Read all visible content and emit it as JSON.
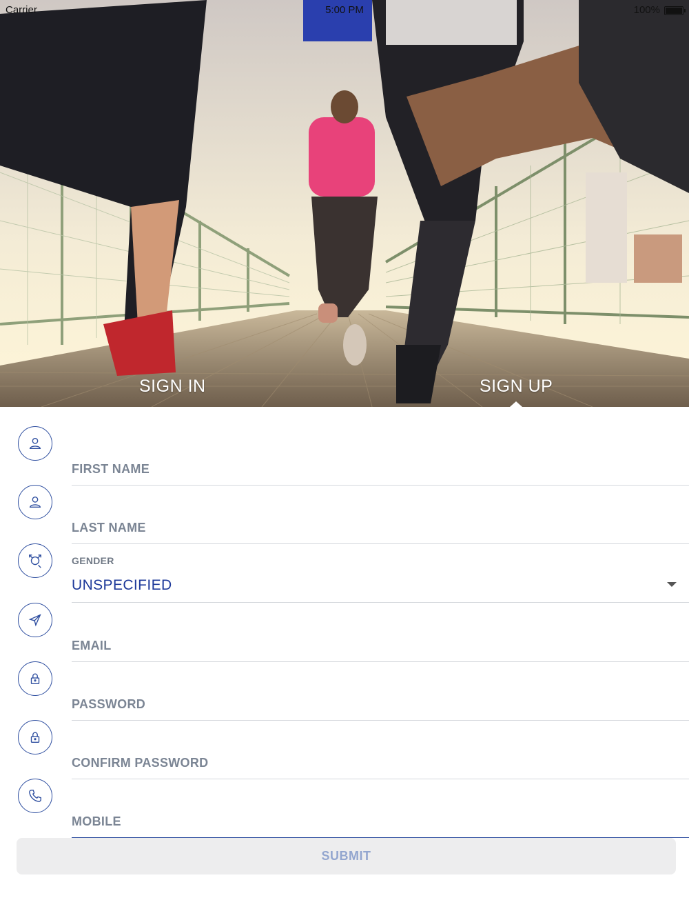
{
  "status_bar": {
    "carrier": "Carrier",
    "time": "5:00 PM",
    "battery": "100%"
  },
  "tabs": {
    "sign_in": "SIGN IN",
    "sign_up": "SIGN UP",
    "active": "sign_up"
  },
  "form": {
    "first_name": {
      "placeholder": "FIRST NAME",
      "icon": "user-icon"
    },
    "last_name": {
      "placeholder": "LAST NAME",
      "icon": "user-icon"
    },
    "gender": {
      "label": "GENDER",
      "value": "UNSPECIFIED",
      "icon": "gender-icon"
    },
    "email": {
      "placeholder": "EMAIL",
      "icon": "send-icon"
    },
    "password": {
      "placeholder": "PASSWORD",
      "icon": "lock-icon"
    },
    "confirm_password": {
      "placeholder": "CONFIRM PASSWORD",
      "icon": "lock-icon"
    },
    "mobile": {
      "placeholder": "MOBILE",
      "icon": "phone-icon"
    }
  },
  "submit_label": "SUBMIT",
  "colors": {
    "accent": "#2f4fa0",
    "placeholder": "#7b8594",
    "value": "#1e3a9a",
    "submit_text": "#93a6cf",
    "submit_bg": "#ededee"
  }
}
